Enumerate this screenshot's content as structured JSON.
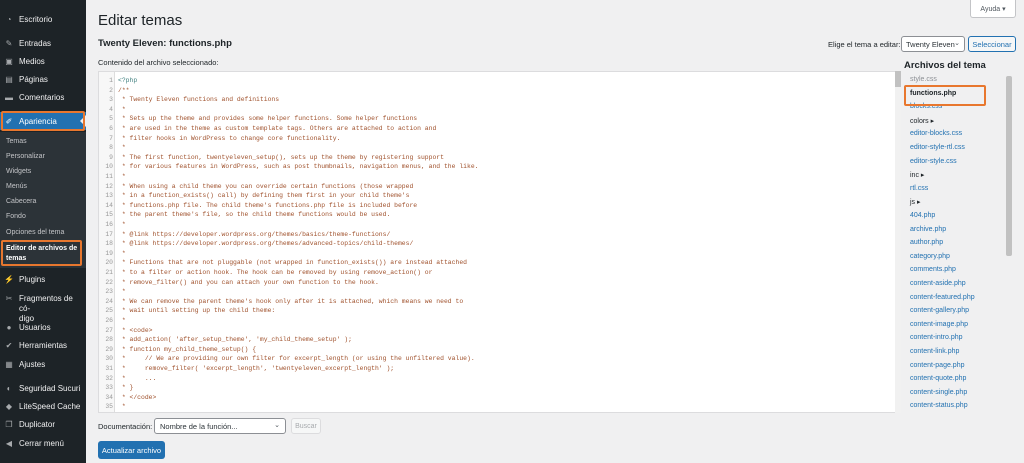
{
  "sidebar": {
    "items": [
      {
        "label": "Escritorio",
        "icon": "dashboard-icon",
        "glyph": "◔"
      },
      {
        "label": "Entradas",
        "icon": "pin-icon",
        "glyph": "✎"
      },
      {
        "label": "Medios",
        "icon": "media-icon",
        "glyph": "▣"
      },
      {
        "label": "Páginas",
        "icon": "pages-icon",
        "glyph": "▤"
      },
      {
        "label": "Comentarios",
        "icon": "comments-icon",
        "glyph": "▬"
      },
      {
        "label": "Apariencia",
        "icon": "paintbrush-icon",
        "glyph": "✐"
      },
      {
        "label": "Plugins",
        "icon": "plugins-icon",
        "glyph": "⚡"
      },
      {
        "label": "Fragmentos de có-",
        "label2": "digo",
        "icon": "snippets-icon",
        "glyph": "✂"
      },
      {
        "label": "Usuarios",
        "icon": "users-icon",
        "glyph": "●"
      },
      {
        "label": "Herramientas",
        "icon": "tools-icon",
        "glyph": "✔"
      },
      {
        "label": "Ajustes",
        "icon": "settings-icon",
        "glyph": "▦"
      },
      {
        "label": "Seguridad Sucuri",
        "icon": "shield-icon",
        "glyph": "◐"
      },
      {
        "label": "LiteSpeed Cache",
        "icon": "litespeed-icon",
        "glyph": "◆"
      },
      {
        "label": "Duplicator",
        "icon": "duplicator-icon",
        "glyph": "❐"
      },
      {
        "label": "Cerrar menú",
        "icon": "collapse-icon",
        "glyph": "◀"
      }
    ],
    "submenu": [
      "Temas",
      "Personalizar",
      "Widgets",
      "Menús",
      "Cabecera",
      "Fondo",
      "Opciones del tema"
    ],
    "submenu_current": [
      "Editor de archivos de",
      "temas"
    ]
  },
  "header": {
    "title": "Editar temas",
    "help": "Ayuda ▾",
    "file_title": "Twenty Eleven: functions.php",
    "choose_label": "Elige el tema a editar:",
    "theme_select": "Twenty Eleven",
    "select_button": "Seleccionar",
    "content_label": "Contenido del archivo seleccionado:"
  },
  "editor": {
    "lines": [
      "<?php",
      "/**",
      " * Twenty Eleven functions and definitions",
      " *",
      " * Sets up the theme and provides some helper functions. Some helper functions",
      " * are used in the theme as custom template tags. Others are attached to action and",
      " * filter hooks in WordPress to change core functionality.",
      " *",
      " * The first function, twentyeleven_setup(), sets up the theme by registering support",
      " * for various features in WordPress, such as post thumbnails, navigation menus, and the like.",
      " *",
      " * When using a child theme you can override certain functions (those wrapped",
      " * in a function_exists() call) by defining them first in your child theme's",
      " * functions.php file. The child theme's functions.php file is included before",
      " * the parent theme's file, so the child theme functions would be used.",
      " *",
      " * @link https://developer.wordpress.org/themes/basics/theme-functions/",
      " * @link https://developer.wordpress.org/themes/advanced-topics/child-themes/",
      " *",
      " * Functions that are not pluggable (not wrapped in function_exists()) are instead attached",
      " * to a filter or action hook. The hook can be removed by using remove_action() or",
      " * remove_filter() and you can attach your own function to the hook.",
      " *",
      " * We can remove the parent theme's hook only after it is attached, which means we need to",
      " * wait until setting up the child theme:",
      " *",
      " * <code>",
      " * add_action( 'after_setup_theme', 'my_child_theme_setup' );",
      " * function my_child_theme_setup() {",
      " *     // We are providing our own filter for excerpt_length (or using the unfiltered value).",
      " *     remove_filter( 'excerpt_length', 'twentyeleven_excerpt_length' );",
      " *     ...",
      " * }",
      " * </code>",
      " *"
    ]
  },
  "files": {
    "heading": "Archivos del tema",
    "items": [
      {
        "name": "style.css",
        "kind": "muted"
      },
      {
        "name": "functions.php",
        "kind": "current"
      },
      {
        "name": "blocks.css",
        "kind": "file"
      },
      {
        "name": "colors ▸",
        "kind": "folder"
      },
      {
        "name": "editor-blocks.css",
        "kind": "file"
      },
      {
        "name": "editor-style-rtl.css",
        "kind": "file"
      },
      {
        "name": "editor-style.css",
        "kind": "file"
      },
      {
        "name": "inc ▸",
        "kind": "folder"
      },
      {
        "name": "rtl.css",
        "kind": "file"
      },
      {
        "name": "js ▸",
        "kind": "folder"
      },
      {
        "name": "404.php",
        "kind": "file"
      },
      {
        "name": "archive.php",
        "kind": "file"
      },
      {
        "name": "author.php",
        "kind": "file"
      },
      {
        "name": "category.php",
        "kind": "file"
      },
      {
        "name": "comments.php",
        "kind": "file"
      },
      {
        "name": "content-aside.php",
        "kind": "file"
      },
      {
        "name": "content-featured.php",
        "kind": "file"
      },
      {
        "name": "content-gallery.php",
        "kind": "file"
      },
      {
        "name": "content-image.php",
        "kind": "file"
      },
      {
        "name": "content-intro.php",
        "kind": "file"
      },
      {
        "name": "content-link.php",
        "kind": "file"
      },
      {
        "name": "content-page.php",
        "kind": "file"
      },
      {
        "name": "content-quote.php",
        "kind": "file"
      },
      {
        "name": "content-single.php",
        "kind": "file"
      },
      {
        "name": "content-status.php",
        "kind": "file"
      }
    ]
  },
  "footer": {
    "doc_label": "Documentación:",
    "doc_select": "Nombre de la función...",
    "search_button": "Buscar",
    "update_button": "Actualizar archivo"
  },
  "colors": {
    "accent": "#2271b1",
    "highlight": "#e8772e",
    "sidebar_bg": "#1d2327"
  }
}
